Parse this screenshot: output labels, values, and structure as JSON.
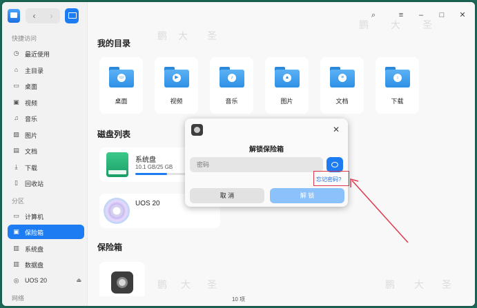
{
  "sidebar": {
    "sections": {
      "quick_access": "快捷访问",
      "partitions": "分区",
      "network": "网络"
    },
    "items": [
      {
        "label": "最近使用",
        "icon": "clock-icon"
      },
      {
        "label": "主目录",
        "icon": "home-icon"
      },
      {
        "label": "桌面",
        "icon": "desktop-icon"
      },
      {
        "label": "视频",
        "icon": "video-icon"
      },
      {
        "label": "音乐",
        "icon": "music-icon"
      },
      {
        "label": "图片",
        "icon": "image-icon"
      },
      {
        "label": "文档",
        "icon": "document-icon"
      },
      {
        "label": "下载",
        "icon": "download-icon"
      },
      {
        "label": "回收站",
        "icon": "trash-icon"
      },
      {
        "label": "计算机",
        "icon": "computer-icon"
      },
      {
        "label": "保险箱",
        "icon": "vault-icon",
        "active": true
      },
      {
        "label": "系统盘",
        "icon": "disk-icon"
      },
      {
        "label": "数据盘",
        "icon": "disk-icon"
      },
      {
        "label": "UOS 20",
        "icon": "disc-icon",
        "eject": "⏏"
      }
    ]
  },
  "main": {
    "my_directory": {
      "heading": "我的目录",
      "folders": [
        {
          "name": "桌面",
          "icon": "desktop-folder-icon"
        },
        {
          "name": "视频",
          "icon": "video-folder-icon"
        },
        {
          "name": "音乐",
          "icon": "music-folder-icon"
        },
        {
          "name": "图片",
          "icon": "image-folder-icon"
        },
        {
          "name": "文档",
          "icon": "document-folder-icon"
        },
        {
          "name": "下载",
          "icon": "download-folder-icon"
        }
      ]
    },
    "disks": {
      "heading": "磁盘列表",
      "items": [
        {
          "name": "系统盘",
          "size": "10.1 GB/25 GB",
          "usage_fraction": 0.4
        },
        {
          "name": "UOS 20"
        }
      ]
    },
    "vault": {
      "heading": "保险箱"
    },
    "status": "10 项"
  },
  "dialog": {
    "title": "解锁保险箱",
    "password_placeholder": "密码",
    "forgot_password": "忘记密码?",
    "cancel_label": "取 消",
    "unlock_label": "解 锁"
  },
  "watermark": {
    "chars": [
      "鹏",
      "大",
      "圣"
    ]
  },
  "colors": {
    "accent": "#1d7cf2",
    "callout": "#e0374d",
    "desktop": "#1d6b5a"
  }
}
